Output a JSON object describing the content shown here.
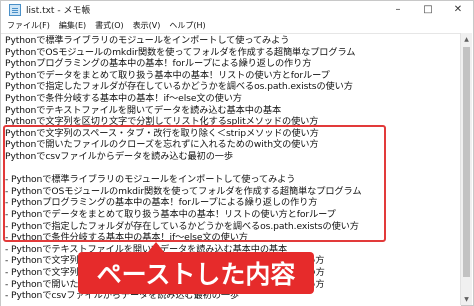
{
  "window": {
    "title": "list.txt - メモ帳",
    "controls": [
      "–",
      "□",
      "✕"
    ]
  },
  "menu": [
    "ファイル(F)",
    "編集(E)",
    "書式(O)",
    "表示(V)",
    "ヘルプ(H)"
  ],
  "editor": {
    "lines": [
      "Pythonで標準ライブラリのモジュールをインポートして使ってみよう",
      "PythonでOSモジュールのmkdir関数を使ってフォルダを作成する超簡単なプログラム",
      "Pythonプログラミングの基本中の基本！forループによる繰り返しの作り方",
      "Pythonでデータをまとめて取り扱う基本中の基本！リストの使い方とforループ",
      "Pythonで指定したフォルダが存在しているかどうかを調べるos.path.existsの使い方",
      "Pythonで条件分岐する基本中の基本！if〜else文の使い方",
      "Pythonでテキストファイルを開いてデータを読み込む基本中の基本",
      "Pythonで文字列を区切り文字で分割してリスト化するsplitメソッドの使い方",
      "Pythonで文字列のスペース・タブ・改行を取り除く＜stripメソッドの使い方",
      "Pythonで開いたファイルのクローズを忘れずに入れるためのwith文の使い方",
      "Pythonでcsvファイルからデータを読み込む最初の一歩",
      "",
      "- Pythonで標準ライブラリのモジュールをインポートして使ってみよう",
      "- PythonでOSモジュールのmkdir関数を使ってフォルダを作成する超簡単なプログラム",
      "- Pythonプログラミングの基本中の基本！forループによる繰り返しの作り方",
      "- Pythonでデータをまとめて取り扱う基本中の基本！リストの使い方とforループ",
      "- Pythonで指定したフォルダが存在しているかどうかを調べるos.path.existsの使い方",
      "- Pythonで条件分岐する基本中の基本！if〜else文の使い方",
      "- Pythonでテキストファイルを開いてデータを読み込む基本中の基本",
      "- Pythonで文字列を区切り文字で分割してリスト化するsplitメソッドの使い方",
      "- Pythonで文字列のスペース・タブ・改行を取り除く＜stripメソッドの使い方",
      "- Pythonで開いたファイルのクローズを忘れずに入れるためのwith文の使い方",
      "- Pythonでcsvファイルからデータを読み込む最初の一歩"
    ]
  },
  "scrollbar": {
    "up": "▲",
    "down": "▼"
  },
  "callout": {
    "text": "ペーストした内容",
    "color": "#e62b2b"
  },
  "colors": {
    "highlight": "#e23a3a"
  }
}
